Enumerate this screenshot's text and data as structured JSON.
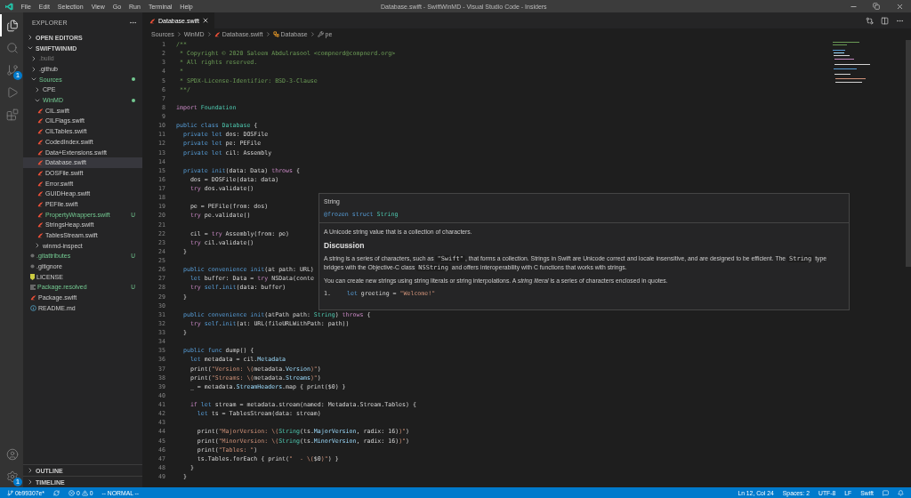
{
  "title_bar": {
    "menu": [
      "File",
      "Edit",
      "Selection",
      "View",
      "Go",
      "Run",
      "Terminal",
      "Help"
    ],
    "title": "Database.swift - SwiftWinMD - Visual Studio Code - Insiders"
  },
  "activity_bar": {
    "items": [
      {
        "kind": "explorer",
        "selected": true
      },
      {
        "kind": "search",
        "selected": false
      },
      {
        "kind": "source-control",
        "selected": false,
        "badge": "1"
      },
      {
        "kind": "run",
        "selected": false
      },
      {
        "kind": "extensions",
        "selected": false
      }
    ],
    "bottom": [
      {
        "kind": "account"
      },
      {
        "kind": "settings",
        "badge": "1"
      }
    ]
  },
  "sidebar": {
    "title": "EXPLORER",
    "open_editors": {
      "label": "OPEN EDITORS",
      "expanded": false
    },
    "workspace": {
      "label": "SWIFTWINMD",
      "expanded": true,
      "items": [
        {
          "kind": "folder",
          "label": ".build",
          "expanded": false,
          "selected": false,
          "ignored": true
        },
        {
          "kind": "folder",
          "label": ".github",
          "expanded": false,
          "selected": false
        },
        {
          "kind": "folder",
          "label": "Sources",
          "expanded": true,
          "selected": false,
          "untracked": true,
          "dot": true,
          "children": [
            {
              "kind": "folder",
              "label": "CPE",
              "expanded": false,
              "selected": false
            },
            {
              "kind": "folder",
              "label": "WinMD",
              "expanded": true,
              "selected": false,
              "untracked": true,
              "dot": true,
              "children": [
                {
                  "kind": "swift",
                  "label": "CIL.swift",
                  "selected": false
                },
                {
                  "kind": "swift",
                  "label": "CILFlags.swift",
                  "selected": false
                },
                {
                  "kind": "swift",
                  "label": "CILTables.swift",
                  "selected": false
                },
                {
                  "kind": "swift",
                  "label": "CodedIndex.swift",
                  "selected": false
                },
                {
                  "kind": "swift",
                  "label": "Data+Extensions.swift",
                  "selected": false
                },
                {
                  "kind": "swift",
                  "label": "Database.swift",
                  "selected": true
                },
                {
                  "kind": "swift",
                  "label": "DOSFile.swift",
                  "selected": false
                },
                {
                  "kind": "swift",
                  "label": "Error.swift",
                  "selected": false
                },
                {
                  "kind": "swift",
                  "label": "GUIDHeap.swift",
                  "selected": false
                },
                {
                  "kind": "swift",
                  "label": "PEFile.swift",
                  "selected": false
                },
                {
                  "kind": "swift",
                  "label": "PropertyWrappers.swift",
                  "selected": false,
                  "untracked": true,
                  "badge": "U"
                },
                {
                  "kind": "swift",
                  "label": "StringsHeap.swift",
                  "selected": false
                },
                {
                  "kind": "swift",
                  "label": "TablesStream.swift",
                  "selected": false
                }
              ]
            },
            {
              "kind": "folder",
              "label": "winmd-inspect",
              "expanded": false,
              "selected": false
            }
          ]
        },
        {
          "kind": "dotfile",
          "label": ".gitattributes",
          "selected": false,
          "untracked": true,
          "badge": "U"
        },
        {
          "kind": "dotfile",
          "label": ".gitignore",
          "selected": false
        },
        {
          "kind": "license",
          "label": "LICENSE",
          "selected": false
        },
        {
          "kind": "manifest",
          "label": "Package.resolved",
          "selected": false,
          "untracked": true,
          "badge": "U"
        },
        {
          "kind": "swift",
          "label": "Package.swift",
          "selected": false
        },
        {
          "kind": "readme",
          "label": "README.md",
          "selected": false
        }
      ]
    },
    "outline": {
      "label": "OUTLINE",
      "expanded": false
    },
    "timeline": {
      "label": "TIMELINE",
      "expanded": false
    }
  },
  "editor": {
    "tab": {
      "label": "Database.swift",
      "selected": true
    },
    "breadcrumbs": [
      {
        "label": "Sources",
        "kind": "folder"
      },
      {
        "label": "WinMD",
        "kind": "folder"
      },
      {
        "label": "Database.swift",
        "kind": "file"
      },
      {
        "label": "Database",
        "kind": "class"
      },
      {
        "label": "pe",
        "kind": "property"
      }
    ],
    "lines": [
      {
        "number": "1",
        "tokens": [
          {
            "kind": "comment",
            "text": "/**"
          }
        ]
      },
      {
        "number": "2",
        "tokens": [
          {
            "kind": "comment",
            "text": " * Copyright © 2020 Saleem Abdulrasool <compnerd@compnerd.org>"
          }
        ]
      },
      {
        "number": "3",
        "tokens": [
          {
            "kind": "comment",
            "text": " * All rights reserved."
          }
        ]
      },
      {
        "number": "4",
        "tokens": [
          {
            "kind": "comment",
            "text": " *"
          }
        ]
      },
      {
        "number": "5",
        "tokens": [
          {
            "kind": "comment",
            "text": " * SPDX-License-Identifier: BSD-3-Clause"
          }
        ]
      },
      {
        "number": "6",
        "tokens": [
          {
            "kind": "comment",
            "text": " **/"
          }
        ]
      },
      {
        "number": "7"
      },
      {
        "number": "8",
        "tokens": [
          {
            "kind": "control",
            "text": "import"
          },
          {
            "kind": "type",
            "text": " Foundation"
          }
        ]
      },
      {
        "number": "9"
      },
      {
        "number": "10",
        "tokens": [
          {
            "kind": "keyword",
            "text": "public class"
          },
          {
            "kind": "type",
            "text": " Database"
          },
          {
            "kind": "plain",
            "text": " {"
          }
        ]
      },
      {
        "number": "11",
        "tokens": [
          {
            "kind": "keyword",
            "text": "  private let"
          },
          {
            "kind": "plain",
            "text": " dos: DOSFile"
          }
        ]
      },
      {
        "number": "12",
        "tokens": [
          {
            "kind": "keyword",
            "text": "  private let"
          },
          {
            "kind": "plain",
            "text": " pe: PEFile"
          }
        ]
      },
      {
        "number": "13",
        "tokens": [
          {
            "kind": "keyword",
            "text": "  private let"
          },
          {
            "kind": "plain",
            "text": " cil: Assembly"
          }
        ]
      },
      {
        "number": "14"
      },
      {
        "number": "15",
        "tokens": [
          {
            "kind": "keyword",
            "text": "  private init"
          },
          {
            "kind": "plain",
            "text": "(data: Data) "
          },
          {
            "kind": "control",
            "text": "throws"
          },
          {
            "kind": "plain",
            "text": " {"
          }
        ]
      },
      {
        "number": "16",
        "tokens": [
          {
            "kind": "plain",
            "text": "    dos = DOSFile(data: data)"
          }
        ]
      },
      {
        "number": "17",
        "tokens": [
          {
            "kind": "control",
            "text": "    try"
          },
          {
            "kind": "plain",
            "text": " dos.validate()"
          }
        ]
      },
      {
        "number": "18"
      },
      {
        "number": "19",
        "tokens": [
          {
            "kind": "plain",
            "text": "    pe = PEFile(from: dos)"
          }
        ]
      },
      {
        "number": "20",
        "tokens": [
          {
            "kind": "control",
            "text": "    try"
          },
          {
            "kind": "plain",
            "text": " pe.validate()"
          }
        ]
      },
      {
        "number": "21"
      },
      {
        "number": "22",
        "tokens": [
          {
            "kind": "plain",
            "text": "    cil = "
          },
          {
            "kind": "control",
            "text": "try"
          },
          {
            "kind": "plain",
            "text": " Assembly(from: pe)"
          }
        ]
      },
      {
        "number": "23",
        "tokens": [
          {
            "kind": "control",
            "text": "    try"
          },
          {
            "kind": "plain",
            "text": " cil.validate()"
          }
        ]
      },
      {
        "number": "24",
        "tokens": [
          {
            "kind": "plain",
            "text": "  }"
          }
        ]
      },
      {
        "number": "25"
      },
      {
        "number": "26",
        "tokens": [
          {
            "kind": "keyword",
            "text": "  public convenience init"
          },
          {
            "kind": "plain",
            "text": "(at path: URL)"
          }
        ]
      },
      {
        "number": "27",
        "tokens": [
          {
            "kind": "keyword",
            "text": "    let"
          },
          {
            "kind": "plain",
            "text": " buffer: Data = "
          },
          {
            "kind": "control",
            "text": "try"
          },
          {
            "kind": "plain",
            "text": " NSData(conte"
          }
        ]
      },
      {
        "number": "28",
        "tokens": [
          {
            "kind": "control",
            "text": "    try"
          },
          {
            "kind": "keyword",
            "text": " self"
          },
          {
            "kind": "plain",
            "text": "."
          },
          {
            "kind": "keyword",
            "text": "init"
          },
          {
            "kind": "plain",
            "text": "(data: buffer)"
          }
        ]
      },
      {
        "number": "29",
        "tokens": [
          {
            "kind": "plain",
            "text": "  }"
          }
        ]
      },
      {
        "number": "30"
      },
      {
        "number": "31",
        "tokens": [
          {
            "kind": "keyword",
            "text": "  public convenience init"
          },
          {
            "kind": "plain",
            "text": "(atPath path: "
          },
          {
            "kind": "type",
            "text": "String"
          },
          {
            "kind": "plain",
            "text": ") "
          },
          {
            "kind": "control",
            "text": "throws"
          },
          {
            "kind": "plain",
            "text": " {"
          }
        ]
      },
      {
        "number": "32",
        "tokens": [
          {
            "kind": "control",
            "text": "    try"
          },
          {
            "kind": "keyword",
            "text": " self"
          },
          {
            "kind": "plain",
            "text": "."
          },
          {
            "kind": "keyword",
            "text": "init"
          },
          {
            "kind": "plain",
            "text": "(at: URL(fileURLWithPath: path))"
          }
        ]
      },
      {
        "number": "33",
        "tokens": [
          {
            "kind": "plain",
            "text": "  }"
          }
        ]
      },
      {
        "number": "34"
      },
      {
        "number": "35",
        "tokens": [
          {
            "kind": "keyword",
            "text": "  public func"
          },
          {
            "kind": "plain",
            "text": " dump() {"
          }
        ]
      },
      {
        "number": "36",
        "tokens": [
          {
            "kind": "keyword",
            "text": "    let"
          },
          {
            "kind": "plain",
            "text": " metadata = cil."
          },
          {
            "kind": "member",
            "text": "Metadata"
          }
        ]
      },
      {
        "number": "37",
        "tokens": [
          {
            "kind": "plain",
            "text": "    print("
          },
          {
            "kind": "string",
            "text": "\"Version: \\("
          },
          {
            "kind": "plain",
            "text": "metadata."
          },
          {
            "kind": "member",
            "text": "Version"
          },
          {
            "kind": "string",
            "text": ")\""
          },
          {
            "kind": "plain",
            "text": ")"
          }
        ]
      },
      {
        "number": "38",
        "tokens": [
          {
            "kind": "plain",
            "text": "    print("
          },
          {
            "kind": "string",
            "text": "\"Streams: \\("
          },
          {
            "kind": "plain",
            "text": "metadata."
          },
          {
            "kind": "member",
            "text": "Streams"
          },
          {
            "kind": "string",
            "text": ")\""
          },
          {
            "kind": "plain",
            "text": ")"
          }
        ]
      },
      {
        "number": "39",
        "tokens": [
          {
            "kind": "plain",
            "text": "    _ = metadata."
          },
          {
            "kind": "member",
            "text": "StreamHeaders"
          },
          {
            "kind": "plain",
            "text": ".map { print($0) }"
          }
        ]
      },
      {
        "number": "40"
      },
      {
        "number": "41",
        "tokens": [
          {
            "kind": "control",
            "text": "    if"
          },
          {
            "kind": "keyword",
            "text": " let"
          },
          {
            "kind": "plain",
            "text": " stream = metadata.stream(named: Metadata.Stream.Tables) {"
          }
        ]
      },
      {
        "number": "42",
        "tokens": [
          {
            "kind": "keyword",
            "text": "      let"
          },
          {
            "kind": "plain",
            "text": " ts = TablesStream(data: stream)"
          }
        ]
      },
      {
        "number": "43"
      },
      {
        "number": "44",
        "tokens": [
          {
            "kind": "plain",
            "text": "      print("
          },
          {
            "kind": "string",
            "text": "\"MajorVersion: \\("
          },
          {
            "kind": "type",
            "text": "String"
          },
          {
            "kind": "plain",
            "text": "(ts."
          },
          {
            "kind": "member",
            "text": "MajorVersion"
          },
          {
            "kind": "plain",
            "text": ", radix: 16)"
          },
          {
            "kind": "string",
            "text": ")\""
          },
          {
            "kind": "plain",
            "text": ")"
          }
        ]
      },
      {
        "number": "45",
        "tokens": [
          {
            "kind": "plain",
            "text": "      print("
          },
          {
            "kind": "string",
            "text": "\"MinorVersion: \\("
          },
          {
            "kind": "type",
            "text": "String"
          },
          {
            "kind": "plain",
            "text": "(ts."
          },
          {
            "kind": "member",
            "text": "MinorVersion"
          },
          {
            "kind": "plain",
            "text": ", radix: 16)"
          },
          {
            "kind": "string",
            "text": ")\""
          },
          {
            "kind": "plain",
            "text": ")"
          }
        ]
      },
      {
        "number": "46",
        "tokens": [
          {
            "kind": "plain",
            "text": "      print("
          },
          {
            "kind": "string",
            "text": "\"Tables: \""
          },
          {
            "kind": "plain",
            "text": ")"
          }
        ]
      },
      {
        "number": "47",
        "tokens": [
          {
            "kind": "plain",
            "text": "      ts.Tables.forEach { print("
          },
          {
            "kind": "string",
            "text": "\"  - \\("
          },
          {
            "kind": "plain",
            "text": "$0"
          },
          {
            "kind": "string",
            "text": ")\""
          },
          {
            "kind": "plain",
            "text": ") }"
          }
        ]
      },
      {
        "number": "48",
        "tokens": [
          {
            "kind": "plain",
            "text": "    }"
          }
        ]
      },
      {
        "number": "49",
        "tokens": [
          {
            "kind": "plain",
            "text": "  }"
          }
        ]
      }
    ],
    "hover": {
      "title": "String",
      "signature": [
        {
          "kind": "keyword",
          "text": "@frozen struct"
        },
        {
          "kind": "type",
          "text": " String"
        }
      ],
      "summary": "A Unicode string value that is a collection of characters.",
      "heading": "Discussion",
      "paragraphs": [
        [
          {
            "kind": "text",
            "text": "A string is a series of characters, such as "
          },
          {
            "kind": "code",
            "text": "\"Swift\""
          },
          {
            "kind": "text",
            "text": ", that forms a collection. Strings in Swift are Unicode correct and locale insensitive, and are designed to be efficient. The "
          },
          {
            "kind": "code",
            "text": "String"
          },
          {
            "kind": "text",
            "text": " type bridges with the Objective-C class "
          },
          {
            "kind": "code",
            "text": "NSString"
          },
          {
            "kind": "text",
            "text": " and offers interoperability with C functions that works with strings."
          }
        ],
        [
          {
            "kind": "text",
            "text": "You can create new strings using string literals or string interpolations. A "
          },
          {
            "kind": "emphasis",
            "text": "string literal"
          },
          {
            "kind": "text",
            "text": " is a series of characters enclosed in quotes."
          }
        ]
      ],
      "sample": {
        "number": "1.",
        "tokens": [
          {
            "kind": "keyword",
            "text": "let"
          },
          {
            "kind": "plain",
            "text": " greeting = "
          },
          {
            "kind": "string",
            "text": "\"Welcome!\""
          }
        ]
      }
    }
  },
  "status_bar": {
    "branch": "0b99307e*",
    "errors": "0",
    "warnings": "0",
    "mode": "-- NORMAL --",
    "position": "Ln 12, Col 24",
    "indentation": "Spaces: 2",
    "encoding": "UTF-8",
    "eol": "LF",
    "language": "Swift"
  }
}
